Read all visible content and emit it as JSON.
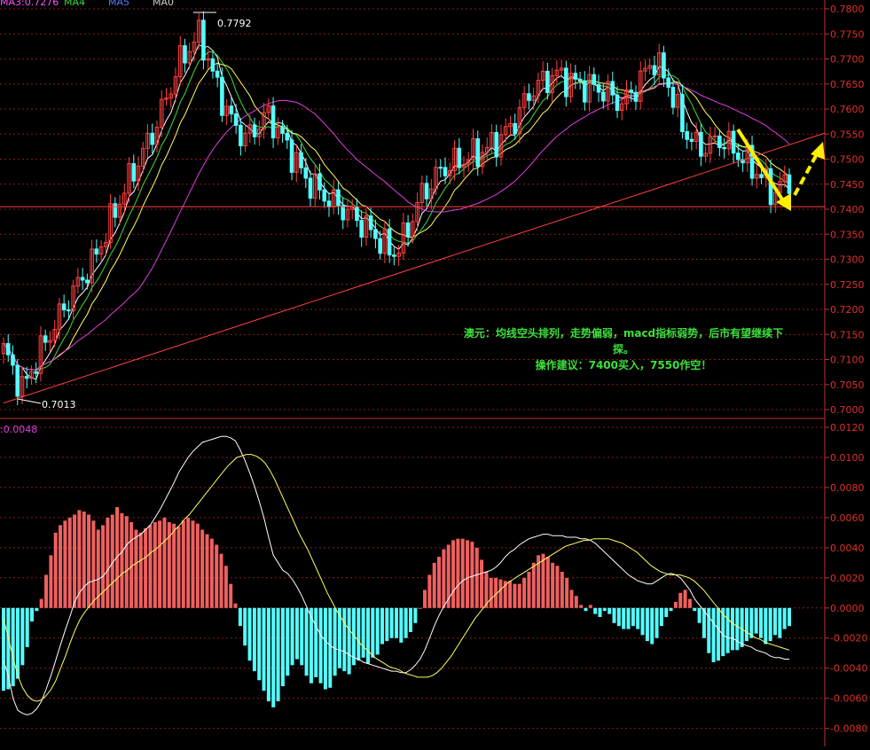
{
  "chart_data": [
    {
      "type": "candlestick",
      "legend": {
        "items": [
          {
            "text": "MA3:0.7276",
            "color": "#ffffff"
          },
          {
            "text": "MA4",
            "color": "#ffff66"
          },
          {
            "text": "MA5",
            "color": "#ff55ff"
          },
          {
            "text": "MA0",
            "color": "#ffffff"
          }
        ]
      },
      "y_ticks": [
        "0.7800",
        "0.7750",
        "0.7700",
        "0.7650",
        "0.7600",
        "0.7550",
        "0.7500",
        "0.7450",
        "0.7400",
        "0.7350",
        "0.7300",
        "0.7250",
        "0.7200",
        "0.7150",
        "0.7100",
        "0.7050",
        "0.7000"
      ],
      "ylim": [
        0.7,
        0.78
      ],
      "high_label": "0.7792",
      "low_label": "0.7013",
      "support_level": 0.7405,
      "annotation": {
        "line1": "澳元：均线空头排列，走势偏弱，macd指标弱势，后市有望继续下",
        "line2": "探。",
        "line3": "操作建议：7400买入，7550作空！"
      },
      "colors": {
        "up": "#ff4040",
        "down": "#54ffff",
        "ma_white": "#ffffff",
        "ma_yellow": "#ffff66",
        "ma_green": "#3ddc3d",
        "ma_magenta": "#e040e0",
        "trend": "#ff4040",
        "arrow": "#ffee00"
      }
    },
    {
      "type": "macd",
      "label": ":0.0048",
      "y_ticks": [
        "0.0120",
        "0.0100",
        "0.0080",
        "0.0060",
        "0.0040",
        "0.0020",
        "0.0000",
        "-0.0020",
        "-0.0040",
        "-0.0060",
        "-0.0080"
      ],
      "ylim": [
        -0.0092,
        0.012
      ],
      "histogram": [
        -0.0055,
        -0.0054,
        -0.0052,
        -0.0047,
        -0.0038,
        -0.0026,
        -0.0009,
        -0.0002,
        0.0006,
        0.0022,
        0.0035,
        0.005,
        0.0055,
        0.0058,
        0.006,
        0.0062,
        0.0065,
        0.0064,
        0.0062,
        0.0058,
        0.0052,
        0.0055,
        0.006,
        0.0062,
        0.0067,
        0.0063,
        0.0061,
        0.0057,
        0.0052,
        0.005,
        0.0053,
        0.0055,
        0.0057,
        0.0058,
        0.006,
        0.0057,
        0.0056,
        0.0054,
        0.0058,
        0.006,
        0.0058,
        0.0056,
        0.0052,
        0.0049,
        0.0046,
        0.0042,
        0.0036,
        0.0028,
        0.0016,
        0.0003,
        -0.0012,
        -0.0025,
        -0.0035,
        -0.0042,
        -0.0048,
        -0.0055,
        -0.0062,
        -0.0066,
        -0.0062,
        -0.0052,
        -0.0045,
        -0.0038,
        -0.0034,
        -0.0038,
        -0.0045,
        -0.005,
        -0.0046,
        -0.005,
        -0.0054,
        -0.0053,
        -0.0045,
        -0.004,
        -0.0042,
        -0.0044,
        -0.0038,
        -0.0035,
        -0.0033,
        -0.0037,
        -0.0033,
        -0.0031,
        -0.0024,
        -0.0022,
        -0.002,
        -0.002,
        -0.0023,
        -0.002,
        -0.0016,
        -0.001,
        0.0,
        0.0012,
        0.0022,
        0.003,
        0.0034,
        0.0039,
        0.0042,
        0.0045,
        0.0046,
        0.0046,
        0.0045,
        0.0044,
        0.004,
        0.0032,
        0.0024,
        0.002,
        0.002,
        0.0019,
        0.0018,
        0.0018,
        0.0016,
        0.0016,
        0.002,
        0.0024,
        0.003,
        0.0035,
        0.0036,
        0.0034,
        0.003,
        0.0028,
        0.0024,
        0.002,
        0.0012,
        0.0008,
        0.0002,
        -0.0002,
        0.0002,
        -0.0004,
        -0.0006,
        -0.0002,
        -0.0004,
        -0.001,
        -0.0012,
        -0.0014,
        -0.0014,
        -0.0012,
        -0.0014,
        -0.0018,
        -0.0022,
        -0.0024,
        -0.002,
        -0.0012,
        -0.0006,
        -0.0002,
        0.0004,
        0.001,
        0.0012,
        0.0006,
        -0.0002,
        -0.001,
        -0.002,
        -0.003,
        -0.0036,
        -0.0035,
        -0.0032,
        -0.003,
        -0.0028,
        -0.0028,
        -0.0026,
        -0.0022,
        -0.002,
        -0.0017,
        -0.002,
        -0.0024,
        -0.0022,
        -0.0018,
        -0.002,
        -0.0014,
        -0.0012
      ],
      "dif": [
        -0.0035,
        -0.0045,
        -0.006,
        -0.0068,
        -0.007,
        -0.0071,
        -0.007,
        -0.0067,
        -0.0062,
        -0.0054,
        -0.0045,
        -0.0035,
        -0.0025,
        -0.0015,
        -0.0006,
        0.0004,
        0.001,
        0.0014,
        0.0017,
        0.0018,
        0.0019,
        0.0021,
        0.0025,
        0.003,
        0.0034,
        0.0037,
        0.0042,
        0.0045,
        0.0047,
        0.0049,
        0.0052,
        0.0055,
        0.006,
        0.0065,
        0.0071,
        0.0077,
        0.0083,
        0.009,
        0.0095,
        0.01,
        0.0104,
        0.0107,
        0.011,
        0.0111,
        0.0112,
        0.0113,
        0.0114,
        0.0114,
        0.0113,
        0.0111,
        0.0105,
        0.0098,
        0.009,
        0.0081,
        0.0071,
        0.006,
        0.0047,
        0.0035,
        0.003,
        0.0025,
        0.0023,
        0.0019,
        0.0014,
        0.0008,
        0.0001,
        -0.0006,
        -0.0012,
        -0.0018,
        -0.0022,
        -0.0025,
        -0.0027,
        -0.0028,
        -0.0029,
        -0.0031,
        -0.0033,
        -0.0034,
        -0.0036,
        -0.0037,
        -0.0038,
        -0.0039,
        -0.004,
        -0.0041,
        -0.0042,
        -0.0042,
        -0.0043,
        -0.0043,
        -0.0041,
        -0.0038,
        -0.0034,
        -0.0028,
        -0.002,
        -0.0012,
        -0.0005,
        0.0001,
        0.0006,
        0.0011,
        0.0015,
        0.0018,
        0.002,
        0.0021,
        0.0022,
        0.0023,
        0.0024,
        0.0025,
        0.0027,
        0.003,
        0.0034,
        0.0037,
        0.0039,
        0.0042,
        0.0044,
        0.0046,
        0.0047,
        0.0048,
        0.0049,
        0.0049,
        0.0048,
        0.0048,
        0.0048,
        0.0047,
        0.0047,
        0.0047,
        0.0046,
        0.0046,
        0.0045,
        0.0043,
        0.004,
        0.0037,
        0.0034,
        0.0031,
        0.0028,
        0.0025,
        0.0022,
        0.002,
        0.0018,
        0.0017,
        0.0016,
        0.0016,
        0.0018,
        0.002,
        0.0022,
        0.0023,
        0.0022,
        0.002,
        0.0016,
        0.0012,
        0.0006,
        0.0002,
        -0.0002,
        -0.0006,
        -0.001,
        -0.0014,
        -0.0018,
        -0.002,
        -0.002,
        -0.0022,
        -0.0024,
        -0.0025,
        -0.0026,
        -0.0028,
        -0.0029,
        -0.003,
        -0.0032,
        -0.0033,
        -0.0033,
        -0.0034,
        -0.0034
      ],
      "dea": [
        -0.0007,
        -0.002,
        -0.0033,
        -0.0045,
        -0.0053,
        -0.0058,
        -0.0061,
        -0.0062,
        -0.0061,
        -0.0058,
        -0.0054,
        -0.0048,
        -0.004,
        -0.0032,
        -0.0023,
        -0.0015,
        -0.0008,
        -0.0003,
        0.0001,
        0.0005,
        0.0008,
        0.0011,
        0.0014,
        0.0017,
        0.002,
        0.0023,
        0.0025,
        0.0028,
        0.003,
        0.0032,
        0.0034,
        0.0037,
        0.0039,
        0.0042,
        0.0045,
        0.0048,
        0.0052,
        0.0055,
        0.0059,
        0.0062,
        0.0066,
        0.007,
        0.0074,
        0.0078,
        0.0082,
        0.0086,
        0.009,
        0.0094,
        0.0097,
        0.01,
        0.0101,
        0.0102,
        0.0102,
        0.0101,
        0.0099,
        0.0096,
        0.0091,
        0.0085,
        0.0078,
        0.0071,
        0.0064,
        0.0057,
        0.005,
        0.0044,
        0.0038,
        0.0031,
        0.0024,
        0.0017,
        0.001,
        0.0004,
        -0.0002,
        -0.0007,
        -0.0012,
        -0.0016,
        -0.002,
        -0.0024,
        -0.0027,
        -0.003,
        -0.0033,
        -0.0035,
        -0.0037,
        -0.0039,
        -0.004,
        -0.0041,
        -0.0043,
        -0.0044,
        -0.0045,
        -0.0046,
        -0.0046,
        -0.0046,
        -0.0045,
        -0.0043,
        -0.004,
        -0.0036,
        -0.0032,
        -0.0027,
        -0.0022,
        -0.0017,
        -0.0012,
        -0.0007,
        -0.0003,
        0.0001,
        0.0005,
        0.0008,
        0.0011,
        0.0014,
        0.0017,
        0.0019,
        0.0021,
        0.0023,
        0.0025,
        0.0027,
        0.0029,
        0.0031,
        0.0033,
        0.0035,
        0.0037,
        0.0039,
        0.0041,
        0.0042,
        0.0043,
        0.0044,
        0.0045,
        0.0045,
        0.0046,
        0.0046,
        0.0046,
        0.0046,
        0.0045,
        0.0044,
        0.0043,
        0.0041,
        0.0039,
        0.0037,
        0.0034,
        0.0031,
        0.0028,
        0.0026,
        0.0024,
        0.0023,
        0.0022,
        0.0022,
        0.0022,
        0.0021,
        0.002,
        0.0018,
        0.0015,
        0.0012,
        0.0008,
        0.0004,
        0.0,
        -0.0004,
        -0.0007,
        -0.001,
        -0.0012,
        -0.0014,
        -0.0016,
        -0.0018,
        -0.002,
        -0.0021,
        -0.0023,
        -0.0024,
        -0.0025,
        -0.0026,
        -0.0027,
        -0.0028
      ]
    }
  ]
}
